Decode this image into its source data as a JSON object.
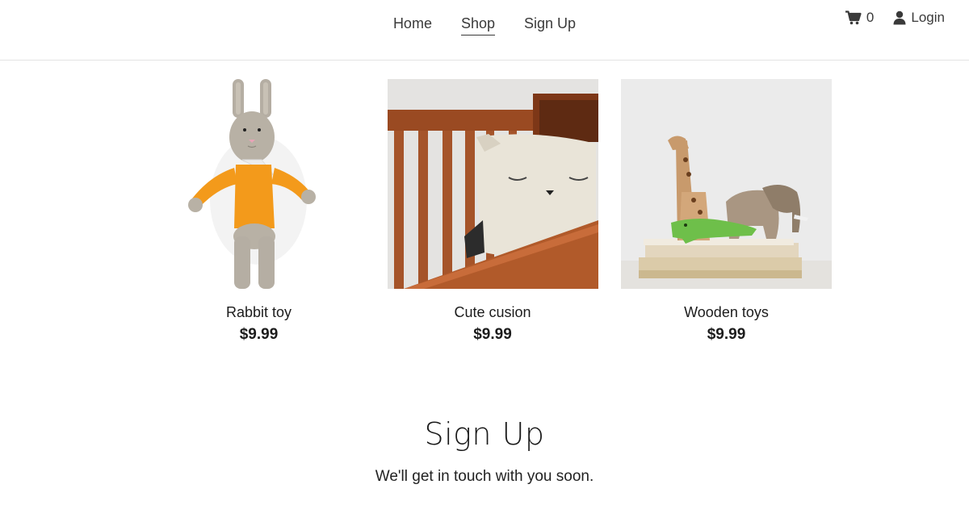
{
  "nav": {
    "items": [
      {
        "label": "Home"
      },
      {
        "label": "Shop"
      },
      {
        "label": "Sign Up"
      }
    ],
    "active": "Shop"
  },
  "header": {
    "cart_count": "0",
    "login_label": "Login",
    "cart_icon": "cart-icon",
    "user_icon": "user-icon"
  },
  "products": [
    {
      "name": "Rabbit toy",
      "price": "$9.99"
    },
    {
      "name": "Cute cusion",
      "price": "$9.99"
    },
    {
      "name": "Wooden toys",
      "price": "$9.99"
    }
  ],
  "signup": {
    "title": "Sign Up",
    "subtitle": "We'll get in touch with you soon."
  },
  "colors": {
    "text": "#1f1f1f",
    "nav_text": "#3a3a3a",
    "border": "#e3e3e3",
    "sweater": "#f39a1b"
  }
}
